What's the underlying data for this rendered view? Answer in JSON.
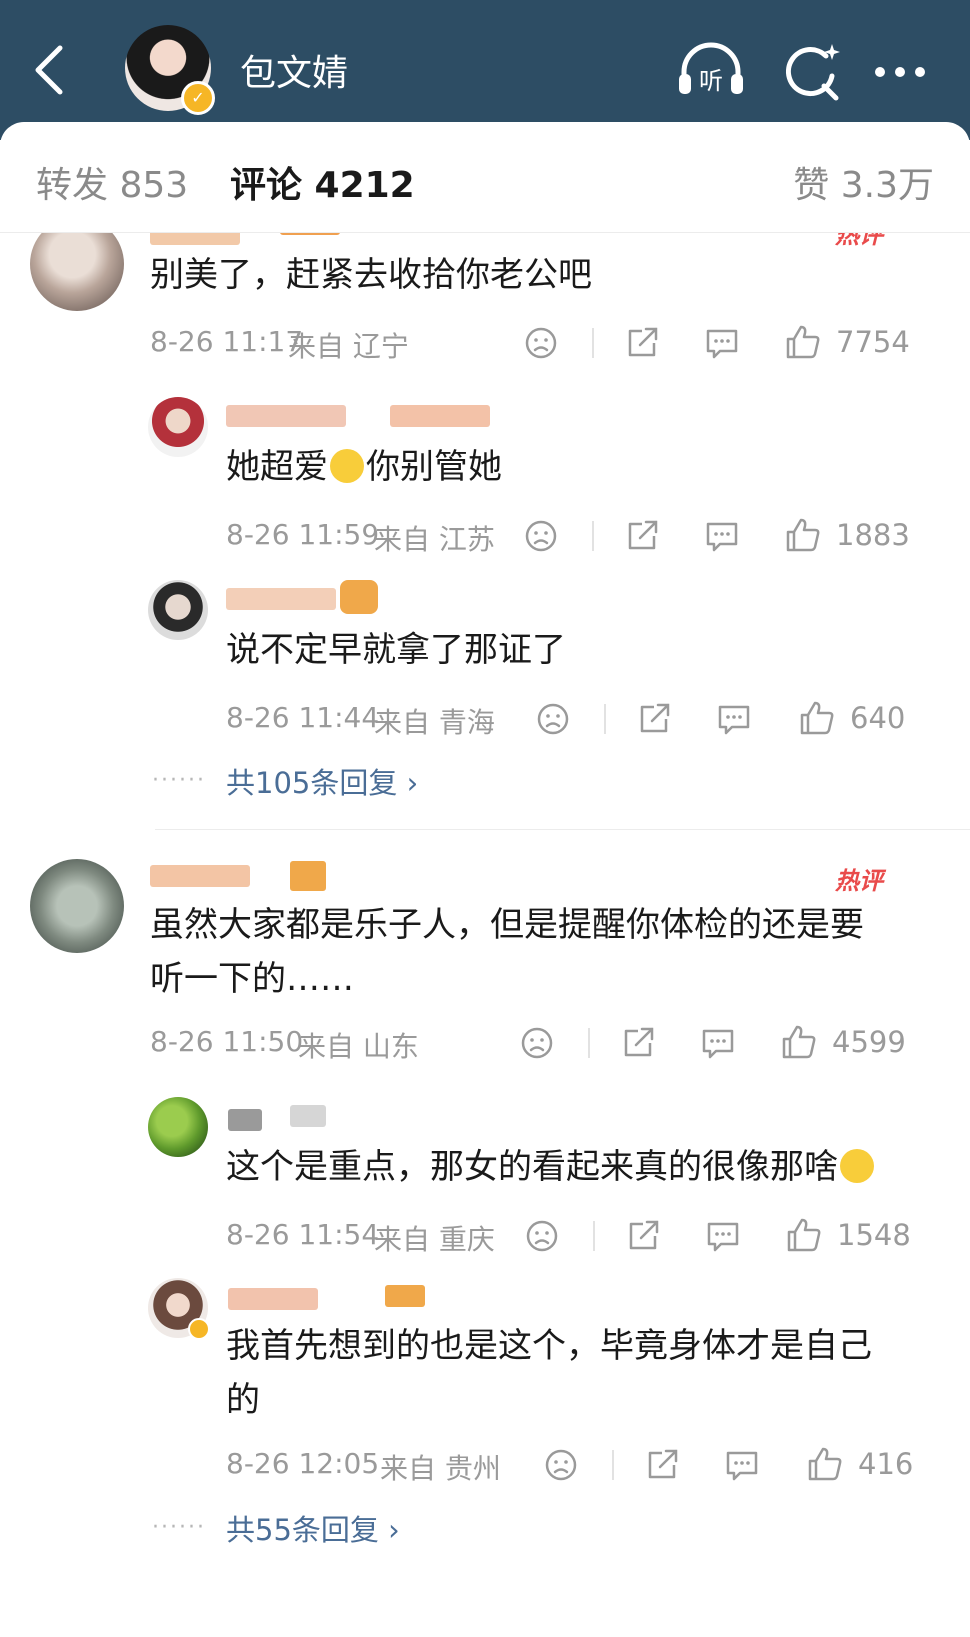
{
  "header": {
    "account_name": "包文婧",
    "icons": [
      "back-icon",
      "listen-icon",
      "search-icon",
      "more-icon"
    ],
    "listen_label": "听"
  },
  "tabs": [
    {
      "label": "转发 853"
    },
    {
      "label": "评论 4212"
    },
    {
      "label": "赞 3.3万"
    }
  ],
  "comments": [
    {
      "hot_label": "热评",
      "text": "别美了，赶紧去收拾你老公吧",
      "time": "8-26 11:17",
      "location": "来自 辽宁",
      "likes": "7754",
      "replies": [
        {
          "text_a": "她超爱",
          "text_b": "你别管她",
          "time": "8-26 11:59",
          "location": "来自 江苏",
          "likes": "1883"
        },
        {
          "text": "说不定早就拿了那证了",
          "time": "8-26 11:44",
          "location": "来自 青海",
          "likes": "640"
        }
      ],
      "more_replies": "共105条回复"
    },
    {
      "hot_label": "热评",
      "text_line1": "虽然大家都是乐子人，但是提醒你体检的还是要",
      "text_line2": "听一下的……",
      "time": "8-26 11:50",
      "location": "来自 山东",
      "likes": "4599",
      "replies": [
        {
          "text": "这个是重点，那女的看起来真的很像那啥",
          "time": "8-26 11:54",
          "location": "来自 重庆",
          "likes": "1548"
        },
        {
          "text_line1": "我首先想到的也是这个，毕竟身体才是自己",
          "text_line2": "的",
          "time": "8-26 12:05",
          "location": "来自 贵州",
          "likes": "416"
        }
      ],
      "more_replies": "共55条回复"
    }
  ],
  "colors": {
    "header_bg": "#2d4d64",
    "link_blue": "#4a6d96",
    "hot_red": "#e94b4b",
    "verified": "#f6b626"
  }
}
